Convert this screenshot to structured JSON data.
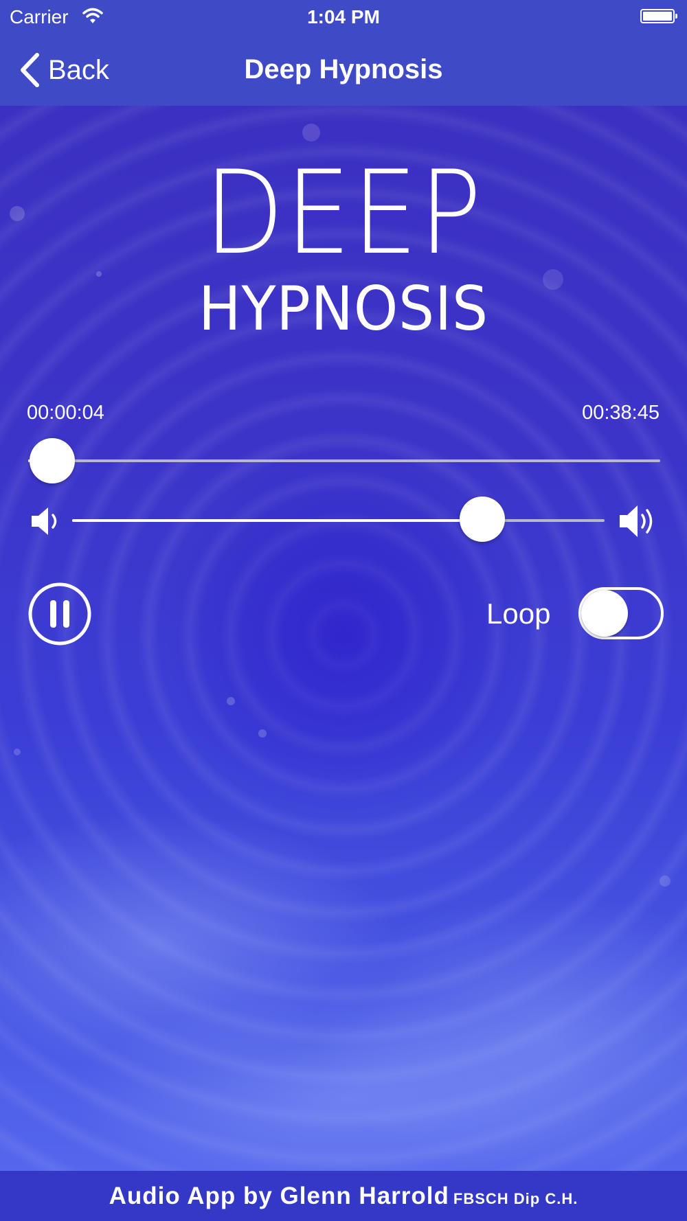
{
  "status_bar": {
    "carrier": "Carrier",
    "time": "1:04 PM",
    "wifi_icon": "wifi-icon",
    "battery_icon": "battery-icon"
  },
  "nav": {
    "back_label": "Back",
    "back_icon": "chevron-left-icon",
    "title": "Deep Hypnosis"
  },
  "logo": {
    "line1": "DEEP",
    "line2": "HYPNOSIS"
  },
  "player": {
    "elapsed": "00:00:04",
    "duration": "00:38:45",
    "progress_fraction": 0.002,
    "volume_fraction": 0.77,
    "volume_min_icon": "speaker-low-icon",
    "volume_max_icon": "speaker-high-icon",
    "state": "playing",
    "pause_icon": "pause-icon"
  },
  "loop": {
    "label": "Loop",
    "enabled": false
  },
  "footer": {
    "text": "Audio App by Glenn Harrold",
    "credentials": "FBSCH Dip C.H."
  },
  "colors": {
    "nav_background": "#3f4ac6",
    "footer_background": "#3338c7",
    "track": "#b8b8c8",
    "text": "#ffffff"
  }
}
